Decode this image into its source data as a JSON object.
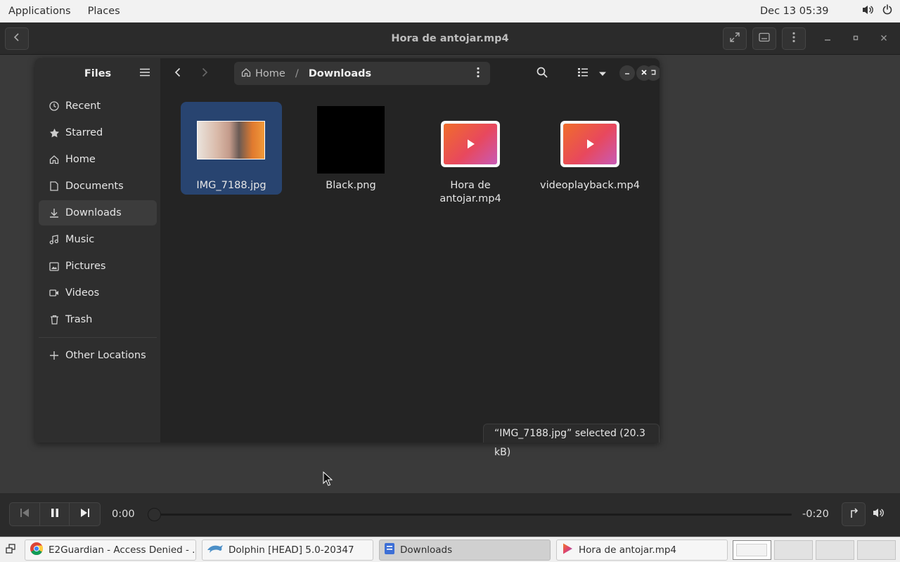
{
  "top_panel": {
    "menus": [
      "Applications",
      "Places"
    ],
    "clock": "Dec 13  05:39",
    "tray_icons": [
      "volume-icon",
      "power-icon"
    ]
  },
  "player": {
    "title": "Hora de antojar.mp4",
    "time_elapsed": "0:00",
    "time_remaining": "-0:20",
    "progress": 0.0
  },
  "files": {
    "sidebar_title": "Files",
    "places": [
      {
        "label": "Recent",
        "icon": "clock-icon"
      },
      {
        "label": "Starred",
        "icon": "star-icon"
      },
      {
        "label": "Home",
        "icon": "home-icon"
      },
      {
        "label": "Documents",
        "icon": "document-icon"
      },
      {
        "label": "Downloads",
        "icon": "download-icon",
        "active": true
      },
      {
        "label": "Music",
        "icon": "music-icon"
      },
      {
        "label": "Pictures",
        "icon": "picture-icon"
      },
      {
        "label": "Videos",
        "icon": "video-icon"
      },
      {
        "label": "Trash",
        "icon": "trash-icon"
      }
    ],
    "other_locations": "Other Locations",
    "breadcrumb": {
      "home": "Home",
      "separator": "/",
      "current": "Downloads"
    },
    "items": [
      {
        "name": "IMG_7188.jpg",
        "type": "image",
        "selected": true
      },
      {
        "name": "Black.png",
        "type": "image-black",
        "selected": false
      },
      {
        "name": "Hora de antojar.mp4",
        "line1": "Hora de",
        "line2": "antojar.mp4",
        "type": "video",
        "selected": false
      },
      {
        "name": "videoplayback.mp4",
        "type": "video",
        "selected": false
      }
    ],
    "status": "“IMG_7188.jpg” selected  (20.3 kB)"
  },
  "taskbar": {
    "tasks": [
      {
        "label": "E2Guardian - Access Denied - ...",
        "icon": "chrome-icon"
      },
      {
        "label": "Dolphin [HEAD] 5.0-20347",
        "icon": "dolphin-icon"
      },
      {
        "label": "Downloads",
        "icon": "files-icon",
        "active": true
      },
      {
        "label": "Hora de antojar.mp4",
        "icon": "video-player-icon"
      }
    ],
    "workspaces": 4,
    "active_workspace": 1
  }
}
